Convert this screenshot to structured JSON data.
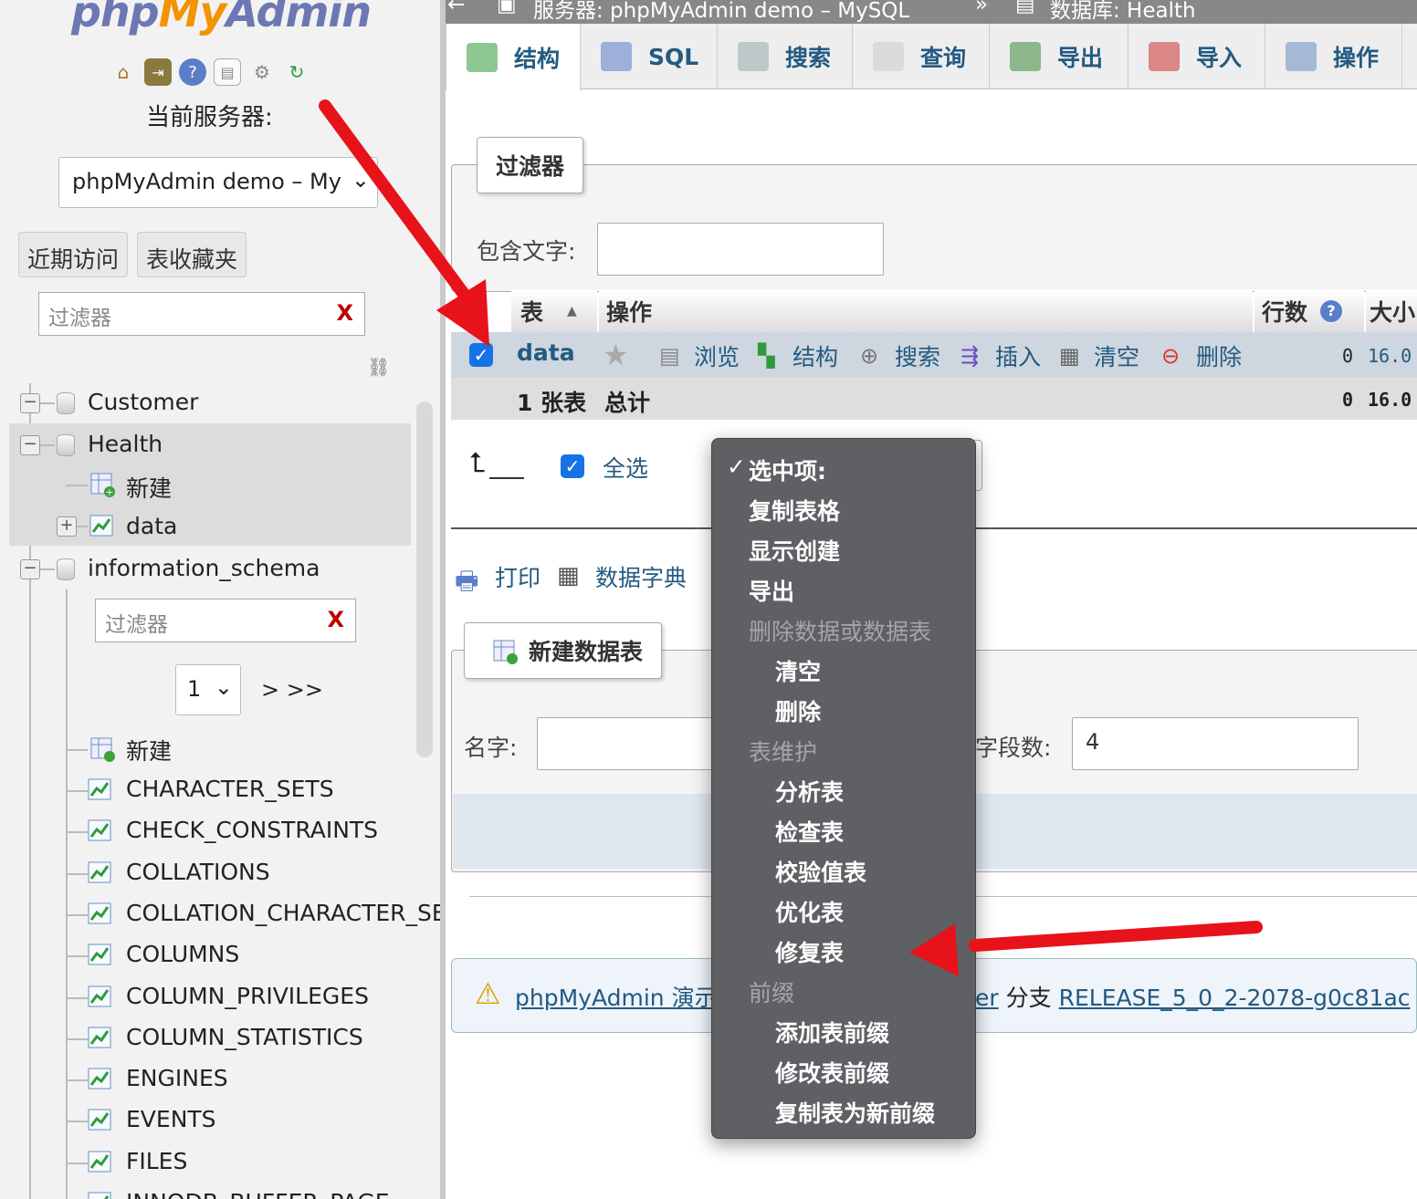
{
  "nav": {
    "logo": {
      "php": "php",
      "my": "My",
      "admin": "Admin"
    },
    "icons": [
      "home-icon",
      "exit-icon",
      "help-icon",
      "docs-icon",
      "settings-icon",
      "reload-icon"
    ],
    "server_label": "当前服务器:",
    "server_select": "phpMyAdmin demo – My",
    "recent_btn": "近期访问",
    "favorites_btn": "表收藏夹",
    "filter_placeholder": "过滤器",
    "filter_clear": "X",
    "tree": {
      "customer": "Customer",
      "health": "Health",
      "health_new": "新建",
      "health_data": "data",
      "info_schema": "information_schema",
      "info_filter_placeholder": "过滤器",
      "info_filter_clear": "X",
      "page_value": "1",
      "page_next": "> >>",
      "info_new": "新建",
      "tables": [
        "CHARACTER_SETS",
        "CHECK_CONSTRAINTS",
        "COLLATIONS",
        "COLLATION_CHARACTER_SET_APPLICABILITY",
        "COLUMNS",
        "COLUMN_PRIVILEGES",
        "COLUMN_STATISTICS",
        "ENGINES",
        "EVENTS",
        "FILES",
        "INNODB_BUFFER_PAGE"
      ]
    }
  },
  "breadcrumb": {
    "back": "←",
    "server": "服务器:  phpMyAdmin demo – MySQL",
    "sep": "»",
    "database": "数据库:  Health"
  },
  "tabs": [
    "结构",
    "SQL",
    "搜索",
    "查询",
    "导出",
    "导入",
    "操作"
  ],
  "filter_section": {
    "legend": "过滤器",
    "contains_label": "包含文字:",
    "contains_value": ""
  },
  "table": {
    "headers": {
      "table": "表",
      "action": "操作",
      "rows": "行数",
      "size": "大小"
    },
    "row": {
      "name": "data",
      "actions": [
        "浏览",
        "结构",
        "搜索",
        "插入",
        "清空",
        "删除"
      ],
      "rows": "0",
      "size": "16.0"
    },
    "total": {
      "count": "1 张表",
      "label": "总计",
      "rows": "0",
      "size": "16.0"
    }
  },
  "bulk": {
    "select_all": "全选"
  },
  "print": {
    "print": "打印",
    "dictionary": "数据字典"
  },
  "create_table": {
    "legend": "新建数据表",
    "name_label": "名字:",
    "name_value": "",
    "fields_label": "字段数:",
    "fields_value": "4"
  },
  "footer": {
    "link1": "phpMyAdmin 演示",
    "frag": "er",
    "branch": "分支",
    "release": "RELEASE_5_0_2-2078-g0c81ac"
  },
  "menu": {
    "checked": "✓",
    "items": [
      {
        "label": "选中项:",
        "type": "checked"
      },
      {
        "label": "复制表格",
        "type": "item"
      },
      {
        "label": "显示创建",
        "type": "item"
      },
      {
        "label": "导出",
        "type": "item"
      },
      {
        "label": "删除数据或数据表",
        "type": "group"
      },
      {
        "label": "清空",
        "type": "sub"
      },
      {
        "label": "删除",
        "type": "sub"
      },
      {
        "label": "表维护",
        "type": "group"
      },
      {
        "label": "分析表",
        "type": "sub"
      },
      {
        "label": "检查表",
        "type": "sub"
      },
      {
        "label": "校验值表",
        "type": "sub"
      },
      {
        "label": "优化表",
        "type": "sub"
      },
      {
        "label": "修复表",
        "type": "sub"
      },
      {
        "label": "前缀",
        "type": "group"
      },
      {
        "label": "添加表前缀",
        "type": "sub"
      },
      {
        "label": "修改表前缀",
        "type": "sub"
      },
      {
        "label": "复制表为新前缀",
        "type": "sub"
      }
    ]
  },
  "colors": {
    "link": "#235a81",
    "accent_red": "#e8121a",
    "checkbox": "#1673e6",
    "menu_bg": "#5e6064"
  }
}
